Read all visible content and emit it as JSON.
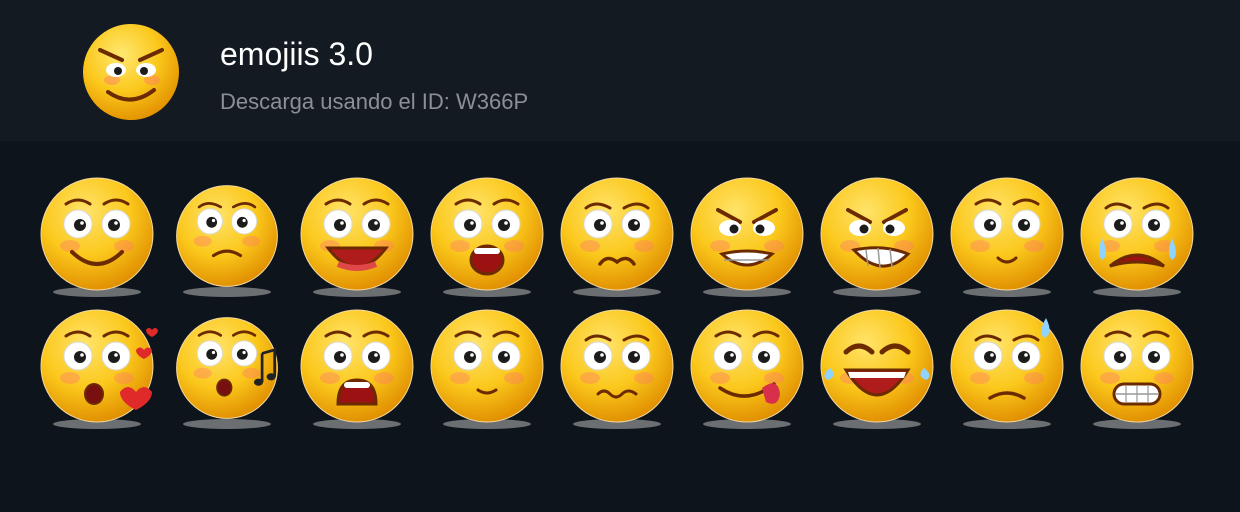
{
  "pack": {
    "title": "emojiis 3.0",
    "subtitle": "Descarga usando el ID: W366P",
    "icon": "angry-smile-emoji"
  },
  "stickers": [
    {
      "name": "sticker-big-smile",
      "kind": "big-smile"
    },
    {
      "name": "sticker-sad-frown",
      "kind": "frown"
    },
    {
      "name": "sticker-laughing",
      "kind": "laugh"
    },
    {
      "name": "sticker-surprised",
      "kind": "surprised"
    },
    {
      "name": "sticker-pouting",
      "kind": "pout"
    },
    {
      "name": "sticker-angry-teeth",
      "kind": "angry-teeth"
    },
    {
      "name": "sticker-angry-grin",
      "kind": "angry-grin"
    },
    {
      "name": "sticker-calm-smile",
      "kind": "calm"
    },
    {
      "name": "sticker-crying",
      "kind": "crying"
    },
    {
      "name": "sticker-blowing-kiss",
      "kind": "kiss"
    },
    {
      "name": "sticker-whistling",
      "kind": "whistle"
    },
    {
      "name": "sticker-shocked",
      "kind": "shocked"
    },
    {
      "name": "sticker-slight-smile",
      "kind": "slight-smile"
    },
    {
      "name": "sticker-wavy-mouth",
      "kind": "wavy"
    },
    {
      "name": "sticker-tongue-out",
      "kind": "tongue"
    },
    {
      "name": "sticker-tears-of-joy",
      "kind": "tears-joy"
    },
    {
      "name": "sticker-sweat-frown",
      "kind": "sweat"
    },
    {
      "name": "sticker-grimacing",
      "kind": "grimace"
    }
  ],
  "colors": {
    "background": "#0e141b",
    "header": "#131a21",
    "title": "#ffffff",
    "subtitle": "#8a9096",
    "face": "#f7b500",
    "face_light": "#ffe36a"
  }
}
